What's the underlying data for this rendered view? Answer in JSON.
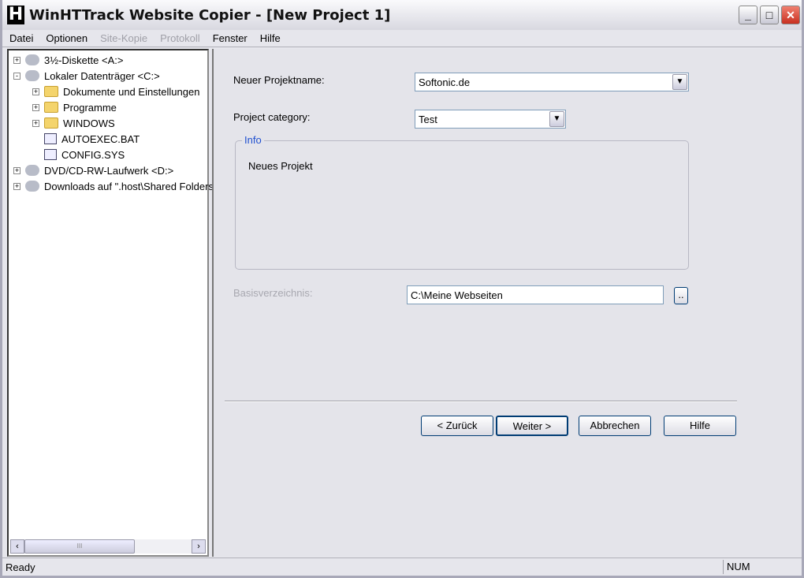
{
  "window": {
    "title": "WinHTTrack Website Copier - [New Project 1]",
    "logo": "H",
    "controls": [
      "minimize",
      "maximize",
      "close"
    ]
  },
  "menu": [
    {
      "label": "Datei",
      "enabled": true
    },
    {
      "label": "Optionen",
      "enabled": true
    },
    {
      "label": "Site-Kopie",
      "enabled": false
    },
    {
      "label": "Protokoll",
      "enabled": false
    },
    {
      "label": "Fenster",
      "enabled": true
    },
    {
      "label": "Hilfe",
      "enabled": true
    }
  ],
  "tree": [
    {
      "label": "3½-Diskette <A:>",
      "icon": "floppy-icon",
      "level": 0,
      "expander": "+"
    },
    {
      "label": "Lokaler Datenträger <C:>",
      "icon": "hard-drive-icon",
      "level": 0,
      "expander": "-"
    },
    {
      "label": "Dokumente und Einstellungen",
      "icon": "folder-icon",
      "level": 1,
      "expander": "+"
    },
    {
      "label": "Programme",
      "icon": "folder-icon",
      "level": 1,
      "expander": "+"
    },
    {
      "label": "WINDOWS",
      "icon": "folder-icon",
      "level": 1,
      "expander": "+"
    },
    {
      "label": "AUTOEXEC.BAT",
      "icon": "batch-file-icon",
      "level": 1,
      "expander": ""
    },
    {
      "label": "CONFIG.SYS",
      "icon": "system-file-icon",
      "level": 1,
      "expander": ""
    },
    {
      "label": "DVD/CD-RW-Laufwerk <D:>",
      "icon": "cd-drive-icon",
      "level": 0,
      "expander": "+"
    },
    {
      "label": "Downloads auf \".host\\Shared Folders\"",
      "icon": "network-drive-icon",
      "level": 0,
      "expander": "+"
    }
  ],
  "form": {
    "project_name_label": "Neuer Projektname:",
    "project_name_value": "Softonic.de",
    "category_label": "Project category:",
    "category_value": "Test",
    "info_title": "Info",
    "info_text": "Neues Projekt",
    "base_dir_label": "Basisverzeichnis:",
    "base_dir_value": "C:\\Meine Webseiten",
    "browse_label": ".."
  },
  "buttons": {
    "back": "< Zurück",
    "next": "Weiter >",
    "cancel": "Abbrechen",
    "help": "Hilfe"
  },
  "status": {
    "text": "Ready",
    "num": "NUM"
  }
}
